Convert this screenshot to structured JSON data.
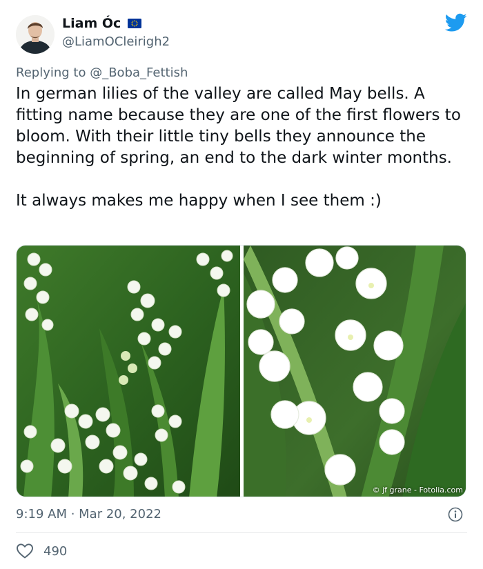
{
  "author": {
    "display_name": "Liam Óc",
    "handle": "@LiamOCleirigh2"
  },
  "reply": {
    "prefix": "Replying to ",
    "mention": "@_Boba_Fettish"
  },
  "tweet_text": "In german lilies of the valley are called May bells. A fitting name because they are one of the first flowers to bloom. With their little tiny bells they announce the beginning of spring, an end to the dark winter months.\n\nIt always makes me happy when I see them :)",
  "media": {
    "credit": "© jf grane - Fotolia.com"
  },
  "timestamp": "9:19 AM · Mar 20, 2022",
  "likes": {
    "count": "490"
  },
  "colors": {
    "twitter_blue": "#1d9bf0",
    "secondary_text": "#536471",
    "eu_blue": "#003399",
    "eu_star": "#ffcc00"
  },
  "icons": {
    "brand": "twitter-bird-icon",
    "info": "info-icon",
    "like": "heart-icon",
    "flag": "eu-flag-icon"
  }
}
